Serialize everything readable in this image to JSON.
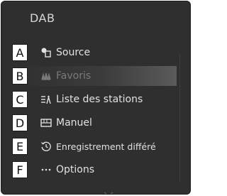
{
  "screen": {
    "title": "DAB"
  },
  "menu": {
    "items": [
      {
        "letter": "A",
        "label": "Source",
        "icon": "source-icon"
      },
      {
        "letter": "B",
        "label": "Favoris",
        "icon": "favorites-icon"
      },
      {
        "letter": "C",
        "label": "Liste des stations",
        "icon": "station-list-icon"
      },
      {
        "letter": "D",
        "label": "Manuel",
        "icon": "manual-tuning-icon"
      },
      {
        "letter": "E",
        "label": "Enregistrement différé",
        "icon": "time-shift-icon"
      },
      {
        "letter": "F",
        "label": "Options",
        "icon": "more-options-icon"
      }
    ]
  },
  "colors": {
    "panel_bg": "#2f2f2f",
    "text": "#e2e2e2",
    "dim_text": "#7a7a7a",
    "callout_bg": "#ffffff"
  }
}
